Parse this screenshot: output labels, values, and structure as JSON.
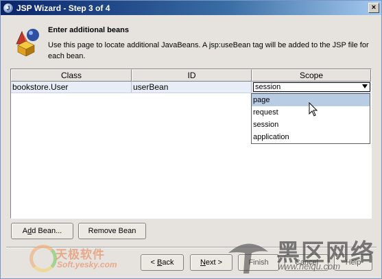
{
  "window": {
    "title": "JSP Wizard - Step 3 of 4",
    "close_glyph": "×"
  },
  "header": {
    "title": "Enter additional beans",
    "description": "Use this page to locate additional JavaBeans. A jsp:useBean tag will be added to the JSP file for each bean."
  },
  "table": {
    "columns": [
      "Class",
      "ID",
      "Scope"
    ],
    "rows": [
      {
        "class": "bookstore.User",
        "id": "userBean",
        "scope": "session"
      }
    ]
  },
  "scope_dropdown": {
    "options": [
      "page",
      "request",
      "session",
      "application"
    ],
    "highlighted": "page"
  },
  "buttons": {
    "add_bean": {
      "pre": "A",
      "ul": "d",
      "post": "d Bean..."
    },
    "remove_bean": "Remove Bean",
    "back": {
      "pre": "< ",
      "ul": "B",
      "post": "ack"
    },
    "next": {
      "ul": "N",
      "post": "ext >"
    },
    "finish": "Finish",
    "cancel": "Cancel",
    "help": "Help"
  },
  "watermarks": {
    "left_title": "天极软件",
    "left_sub": "Soft.yesky.com",
    "right_title": "黑区网络",
    "right_sub": "www.heiqu.com"
  },
  "colors": {
    "title_bar": "#0a246a",
    "selected_row": "#e8eef8",
    "highlighted_option": "#b8cce4"
  }
}
